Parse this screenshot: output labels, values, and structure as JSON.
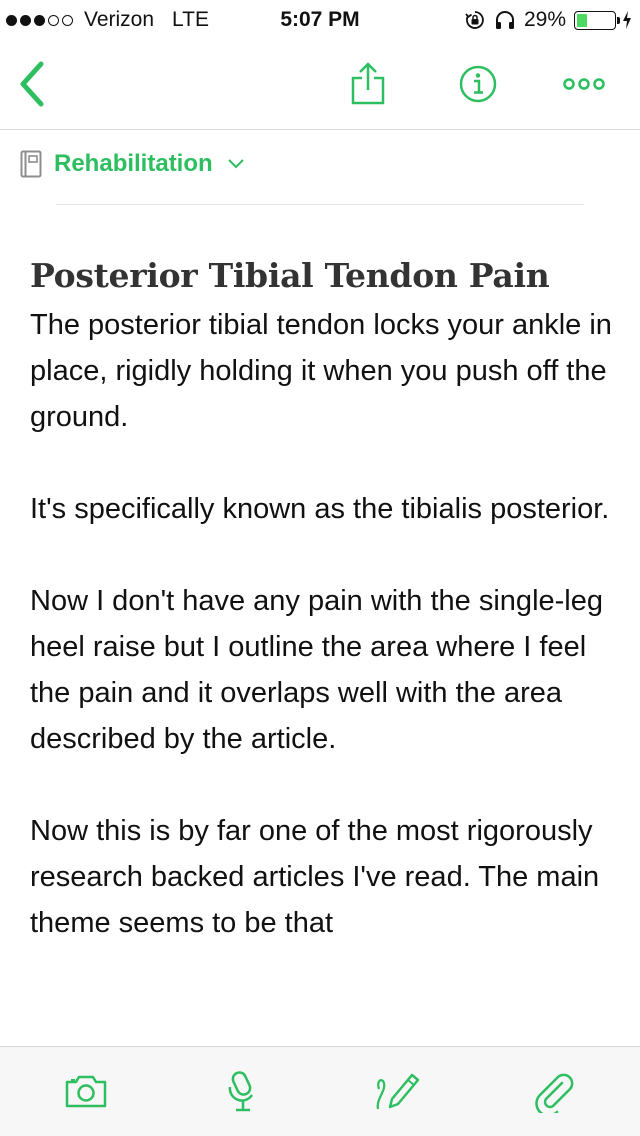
{
  "status_bar": {
    "carrier": "Verizon",
    "network": "LTE",
    "time": "5:07 PM",
    "battery_percent": "29%",
    "battery_level": 0.29,
    "signal_bars": 3,
    "signal_total": 5
  },
  "nav": {
    "back_icon": "chevron-left-icon",
    "share_icon": "share-icon",
    "info_icon": "info-icon",
    "more_icon": "more-icon"
  },
  "notebook": {
    "name": "Rehabilitation"
  },
  "note": {
    "title": "Posterior Tibial Tendon Pain",
    "paragraphs": [
      "The posterior tibial tendon locks your ankle in place, rigidly holding it when you push off the ground.",
      "It's specifically known as the tibialis posterior.",
      "Now I don't have any pain with the single-leg heel raise but I outline the area where I feel the pain and it overlaps well with the area described by the article.",
      "Now this is by far one of the most rigorously research backed articles I've read. The main theme seems to be that"
    ]
  },
  "toolbar": {
    "items": [
      "camera-icon",
      "microphone-icon",
      "handwriting-icon",
      "attachment-icon"
    ]
  },
  "colors": {
    "accent": "#2dbe60",
    "battery": "#4cd964"
  }
}
